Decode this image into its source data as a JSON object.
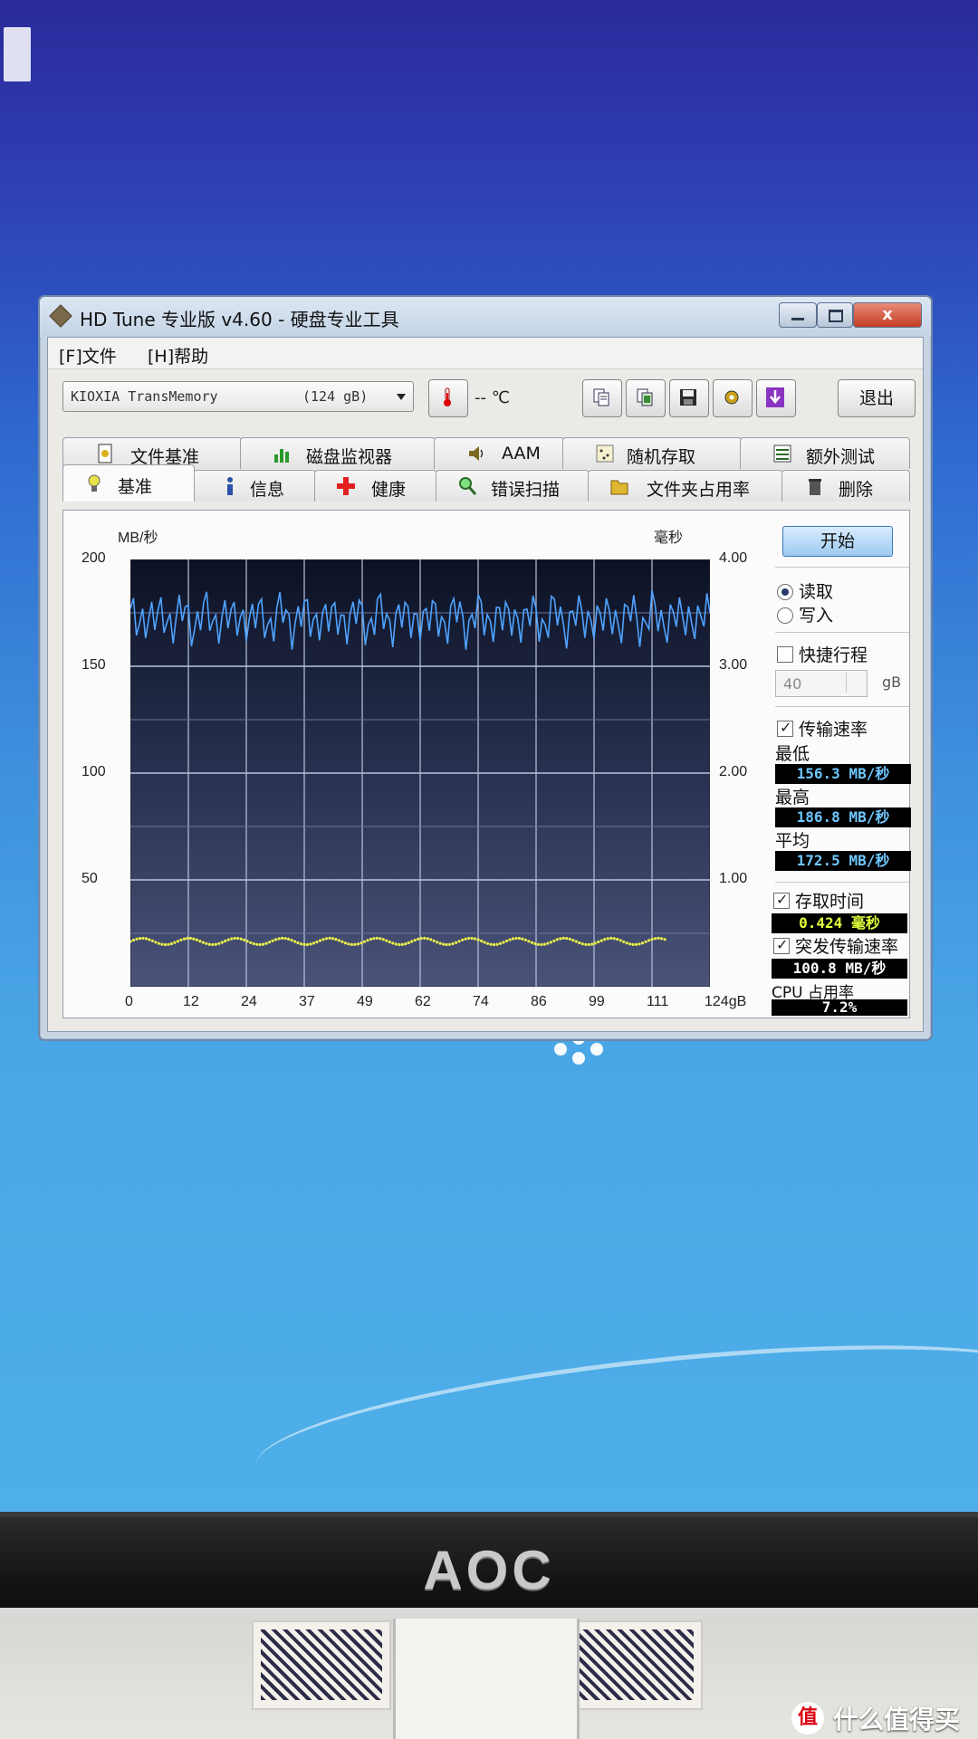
{
  "window": {
    "title": "HD Tune 专业版 v4.60 - 硬盘专业工具",
    "close_label": "x"
  },
  "menu": {
    "file": "[F]文件",
    "help": "[H]帮助"
  },
  "toolbar": {
    "drive_name": "KIOXIA  TransMemory",
    "drive_capacity": "(124 gB)",
    "temperature": "--  ℃",
    "exit_label": "退出"
  },
  "tabs": {
    "top": [
      "文件基准",
      "磁盘监视器",
      "AAM",
      "随机存取",
      "额外测试"
    ],
    "bottom": [
      "基准",
      "信息",
      "健康",
      "错误扫描",
      "文件夹占用率",
      "删除"
    ]
  },
  "benchmark": {
    "start_label": "开始",
    "read_label": "读取",
    "write_label": "写入",
    "short_stroke_label": "快捷行程",
    "short_stroke_value": "40",
    "short_stroke_unit": "gB",
    "transfer_rate_label": "传输速率",
    "min_label": "最低",
    "min_value": "156.3 MB/秒",
    "max_label": "最高",
    "max_value": "186.8 MB/秒",
    "avg_label": "平均",
    "avg_value": "172.5 MB/秒",
    "access_time_label": "存取时间",
    "access_time_value": "0.424 毫秒",
    "burst_rate_label": "突发传输速率",
    "burst_rate_value": "100.8 MB/秒",
    "cpu_label": "CPU 占用率",
    "cpu_value": "7.2%"
  },
  "chart_data": {
    "type": "line",
    "ylabel_left": "MB/秒",
    "ylabel_right": "毫秒",
    "left_ticks": [
      "200",
      "150",
      "100",
      "50"
    ],
    "right_ticks": [
      "4.00",
      "3.00",
      "2.00",
      "1.00"
    ],
    "x_ticks": [
      "0",
      "12",
      "24",
      "37",
      "49",
      "62",
      "74",
      "86",
      "99",
      "111",
      "124gB"
    ],
    "ylim_left": [
      0,
      200
    ],
    "ylim_right": [
      0,
      4
    ],
    "xlim": [
      0,
      124
    ],
    "grid": true,
    "series": [
      {
        "name": "传输速率",
        "color": "#4fa3ff",
        "min": 156.3,
        "max": 186.8,
        "avg": 172.5
      },
      {
        "name": "存取时间",
        "color": "#e9f04a",
        "value": 0.424
      }
    ]
  },
  "desktop": {
    "monitor_brand": "AOC",
    "watermark": "什么值得买"
  }
}
